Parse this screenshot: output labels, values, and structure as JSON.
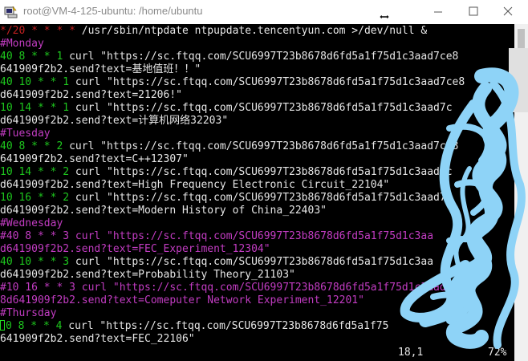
{
  "window": {
    "title": "root@VM-4-125-ubuntu: /home/ubuntu",
    "app_icon": "putty-icon",
    "resize_cursor": "horizontal-resize-cursor-icon",
    "controls": {
      "minimize": "minimize-icon",
      "maximize": "maximize-icon",
      "close": "close-icon"
    }
  },
  "terminal": {
    "lines": [
      {
        "segs": [
          {
            "t": "*/20 * * * * ",
            "c": "red"
          },
          {
            "t": "/usr/sbin/ntpdate ntpupdate.tencentyun.com >/dev/null &",
            "c": "white"
          }
        ]
      },
      {
        "segs": [
          {
            "t": "#Monday",
            "c": "purple"
          }
        ]
      },
      {
        "segs": [
          {
            "t": "40 8 * * 1 ",
            "c": "green"
          },
          {
            "t": "curl \"https://sc.ftqq.com/SCU6997T23b8678d6fd5a1f75d1c3aad7ce8",
            "c": "white"
          }
        ]
      },
      {
        "segs": [
          {
            "t": "641909f2b2.send?text=基地值班！！\"",
            "c": "white"
          }
        ]
      },
      {
        "segs": [
          {
            "t": "40 10 * * 1 ",
            "c": "green"
          },
          {
            "t": "curl \"https://sc.ftqq.com/SCU6997T23b8678d6fd5a1f75d1c3aad7ce8",
            "c": "white"
          }
        ]
      },
      {
        "segs": [
          {
            "t": "d641909f2b2.send?text=21206!\"",
            "c": "white"
          }
        ]
      },
      {
        "segs": [
          {
            "t": "10 14 * * 1 ",
            "c": "green"
          },
          {
            "t": "curl \"https://sc.ftqq.com/SCU6997T23b8678d6fd5a1f75d1c3aad7c",
            "c": "white"
          }
        ]
      },
      {
        "segs": [
          {
            "t": "d641909f2b2.send?text=计算机网络32203\"",
            "c": "white"
          }
        ]
      },
      {
        "segs": [
          {
            "t": "#Tuesday",
            "c": "purple"
          }
        ]
      },
      {
        "segs": [
          {
            "t": "40 8 * * 2 ",
            "c": "green"
          },
          {
            "t": "curl \"https://sc.ftqq.com/SCU6997T23b8678d6fd5a1f75d1c3aad7ce8",
            "c": "white"
          }
        ]
      },
      {
        "segs": [
          {
            "t": "641909f2b2.send?text=C++12307\"",
            "c": "white"
          }
        ]
      },
      {
        "segs": [
          {
            "t": "10 14 * * 2 ",
            "c": "green"
          },
          {
            "t": "curl \"https://sc.ftqq.com/SCU6997T23b8678d6fd5a1f75d1c3aad7c",
            "c": "white"
          }
        ]
      },
      {
        "segs": [
          {
            "t": "d641909f2b2.send?text=High Frequency Electronic Circuit_22104\"",
            "c": "white"
          }
        ]
      },
      {
        "segs": [
          {
            "t": "10 16 * * 2 ",
            "c": "green"
          },
          {
            "t": "curl \"https://sc.ftqq.com/SCU6997T23b8678d6fd5a1f75d1c3aad7c",
            "c": "white"
          }
        ]
      },
      {
        "segs": [
          {
            "t": "d641909f2b2.send?text=Modern History of China_22403\"",
            "c": "white"
          }
        ]
      },
      {
        "segs": [
          {
            "t": "#Wednesday",
            "c": "purple"
          }
        ]
      },
      {
        "segs": [
          {
            "t": "#40 8 * * 3 curl \"https://sc.ftqq.com/SCU6997T23b8678d6fd5a1f75d1c3aa",
            "c": "purple"
          }
        ]
      },
      {
        "segs": [
          {
            "t": "d641909f2b2.send?text=FEC_Experiment_12304\"",
            "c": "purple"
          }
        ]
      },
      {
        "segs": [
          {
            "t": "40 10 * * 3 ",
            "c": "green"
          },
          {
            "t": "curl \"https://sc.ftqq.com/SCU6997T23b8678d6fd5a1f75d1c3aa",
            "c": "white"
          }
        ]
      },
      {
        "segs": [
          {
            "t": "d641909f2b2.send?text=Probability Theory_21103\"",
            "c": "white"
          }
        ]
      },
      {
        "segs": [
          {
            "t": "#10 16 * * 3 curl \"https://sc.ftqq.com/SCU6997T23b8678d6fd5a1f75d1c3aad7ce8",
            "c": "purple"
          }
        ]
      },
      {
        "segs": [
          {
            "t": "8d641909f2b2.send?text=Comeputer Network Experiment_12201\"",
            "c": "purple"
          }
        ]
      },
      {
        "segs": [
          {
            "t": "#Thursday",
            "c": "purple"
          }
        ]
      },
      {
        "segs": [
          {
            "t": "0 8 * * 4 ",
            "c": "green",
            "cursor": true
          },
          {
            "t": "curl \"https://sc.ftqq.com/SCU6997T23b8678d6fd5a1f75",
            "c": "white"
          }
        ]
      },
      {
        "segs": [
          {
            "t": "641909f2b2.send?text=FEC_22106\"",
            "c": "white"
          }
        ]
      }
    ],
    "cursor_position": "18,1",
    "scroll_percent": "72%"
  },
  "colors": {
    "terminal_bg": "#000000",
    "comment": "#c23cc2",
    "schedule": "#1ec81e",
    "text": "#e6e6e6",
    "scribble": "#8ed3f7"
  }
}
